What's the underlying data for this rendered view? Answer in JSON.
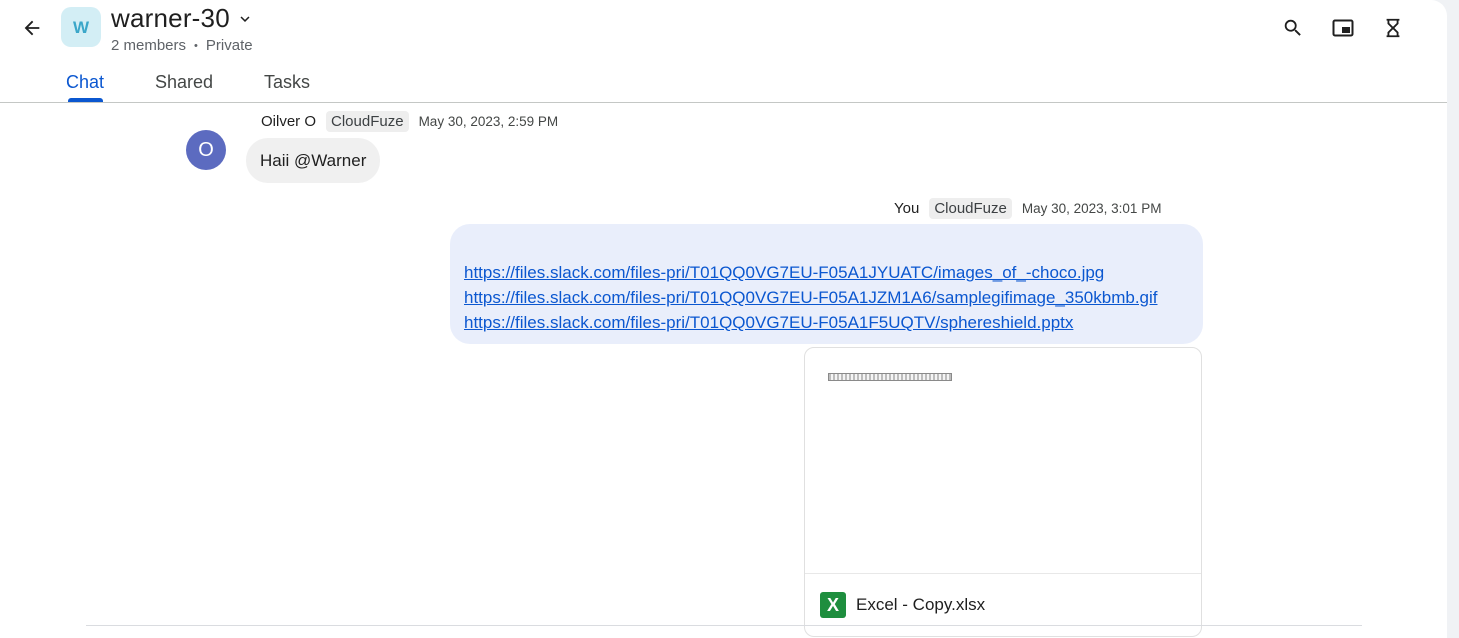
{
  "header": {
    "space_initial": "W",
    "space_name": "warner-30",
    "members": "2 members",
    "separator": "•",
    "visibility": "Private",
    "icons": [
      "back-arrow-icon",
      "chevron-down-icon",
      "search-icon",
      "picture-in-picture-icon",
      "hourglass-icon"
    ]
  },
  "tabs": [
    {
      "label": "Chat",
      "active": true
    },
    {
      "label": "Shared",
      "active": false
    },
    {
      "label": "Tasks",
      "active": false
    }
  ],
  "messages": [
    {
      "avatar_initial": "O",
      "sender": "Oilver O",
      "org": "CloudFuze",
      "time": "May 30, 2023, 2:59 PM",
      "text": "Haii @Warner"
    },
    {
      "sender": "You",
      "org": "CloudFuze",
      "time": "May 30, 2023, 3:01 PM",
      "links": [
        "https://files.slack.com/files-pri/T01QQ0VG7EU-F05A1JYUATC/images_of_-choco.jpg",
        "https://files.slack.com/files-pri/T01QQ0VG7EU-F05A1JZM1A6/samplegifimage_350kbmb.gif",
        "https://files.slack.com/files-pri/T01QQ0VG7EU-F05A1F5UQTV/sphereshield.pptx"
      ],
      "attachment": {
        "icon_letter": "X",
        "name": "Excel - Copy.xlsx"
      }
    }
  ],
  "colors": {
    "accent": "#0b57d0",
    "avatar": "#5c6bc0",
    "space_avatar_bg": "#d3eef5",
    "excel_green": "#1e8e3e",
    "outgoing_bubble": "#e9eefb"
  }
}
